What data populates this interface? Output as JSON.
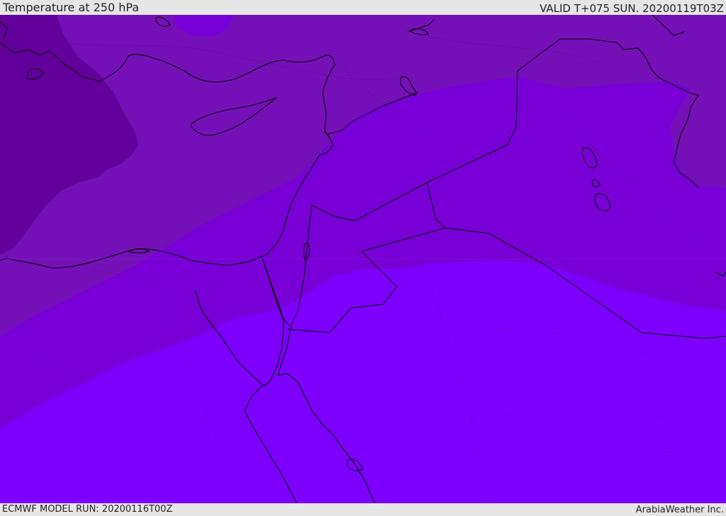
{
  "header": {
    "title": "Temperature at 250 hPa",
    "valid": "VALID T+075 SUN. 20200119T03Z"
  },
  "footer": {
    "model_run": "ECMWF MODEL RUN: 20200116T00Z",
    "credit": "ArabiaWeather Inc."
  },
  "map": {
    "colors": {
      "coldest": "#63009c",
      "cold": "#7510b8",
      "mid": "#7800d6",
      "warm": "#7d00fe",
      "coastline": "#000000"
    }
  }
}
